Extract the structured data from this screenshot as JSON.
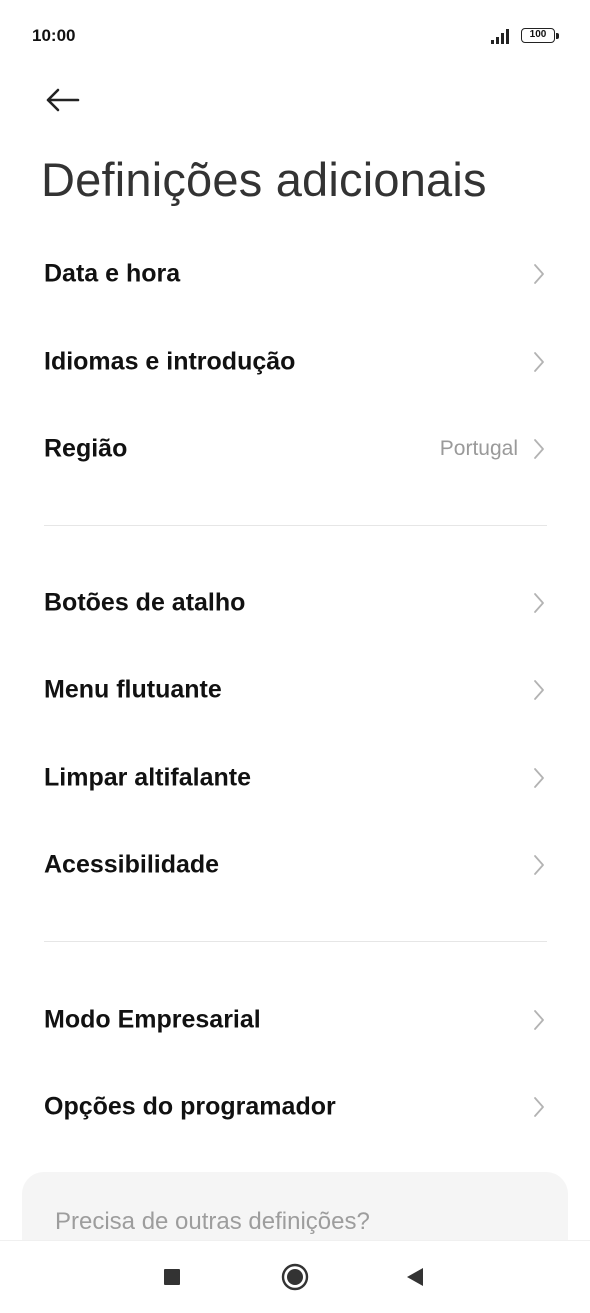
{
  "status_bar": {
    "time": "10:00",
    "battery": "100"
  },
  "header": {
    "title": "Definições adicionais",
    "back_icon": "arrow-left-icon"
  },
  "groups": [
    {
      "items": [
        {
          "label": "Data e hora",
          "value": ""
        },
        {
          "label": "Idiomas e introdução",
          "value": ""
        },
        {
          "label": "Região",
          "value": "Portugal"
        }
      ]
    },
    {
      "items": [
        {
          "label": "Botões de atalho",
          "value": ""
        },
        {
          "label": "Menu flutuante",
          "value": ""
        },
        {
          "label": "Limpar altifalante",
          "value": ""
        },
        {
          "label": "Acessibilidade",
          "value": ""
        }
      ]
    },
    {
      "items": [
        {
          "label": "Modo Empresarial",
          "value": ""
        },
        {
          "label": "Opções do programador",
          "value": ""
        }
      ]
    }
  ],
  "help_card": {
    "text": "Precisa de outras definições?"
  },
  "nav_bar": {
    "recents_icon": "square-icon",
    "home_icon": "circle-icon",
    "back_icon": "triangle-back-icon"
  }
}
